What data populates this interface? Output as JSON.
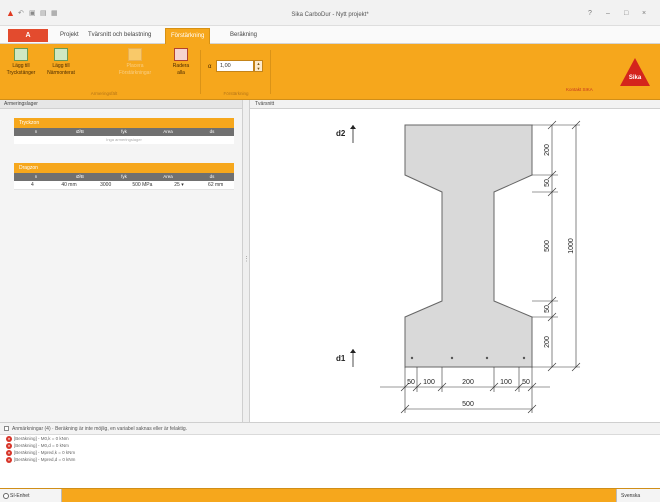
{
  "titlebar": {
    "title": "Sika CarboDur - Nytt projekt*",
    "quick_icons": [
      "undo-icon",
      "save-icon",
      "save-as-icon",
      "print-icon"
    ],
    "controls": [
      "?",
      "–",
      "□",
      "×"
    ]
  },
  "menu": {
    "file_label": "A",
    "tabs": [
      {
        "label": "Projekt",
        "active": false
      },
      {
        "label": "Tvärsnitt och belastning",
        "active": false
      },
      {
        "label": "Förstärkning",
        "active": true
      },
      {
        "label": "Beräkning",
        "active": false
      }
    ]
  },
  "ribbon": {
    "buttons": [
      {
        "label": "Lägg till\nTryckstänger",
        "icon": "add-strip-icon",
        "enabled": true
      },
      {
        "label": "Lägg till\nNärmonterat",
        "icon": "add-nsm-icon",
        "enabled": true
      },
      {
        "label": "Placera\nFörstärkningar",
        "icon": "place-icon",
        "enabled": false
      },
      {
        "label": "Radera\nalla",
        "icon": "delete-all-icon",
        "enabled": true
      }
    ],
    "group_labels": [
      "Armeringsfält",
      "Förstärkning"
    ],
    "factor_label": "α",
    "factor_value": "1,00",
    "accent": "#f6a71c"
  },
  "brand": {
    "logo_text": "Sika",
    "link": "Kontakt SIKA"
  },
  "left_panel": {
    "title": "Armeringslager",
    "top_box": {
      "title": "Tryckzon",
      "columns": [
        "n",
        "Ø/B",
        "fyk",
        "Area",
        "ds"
      ],
      "empty_text": "Inga armeringslager"
    },
    "bottom_box": {
      "title": "Dragzon",
      "columns": [
        "n",
        "Ø/B",
        "fyk",
        "Area",
        "ds"
      ],
      "rows": [
        [
          "4",
          "40 mm",
          "3000",
          "500 MPa",
          "25 ▾",
          "62 mm"
        ]
      ]
    }
  },
  "right_panel": {
    "title": "Tvärsnitt",
    "labels": {
      "d1": "d1",
      "d2": "d2"
    },
    "right_dims": [
      "200",
      "50",
      "500",
      "50",
      "200"
    ],
    "total_height": "1000",
    "bottom_dims": [
      "50",
      "100",
      "200",
      "100",
      "50"
    ],
    "total_width": "500",
    "section_fill": "#d9d9d9"
  },
  "messages": {
    "header": "Anmärkningar (4) · Beräkning är inte möjlig, en variabel saknas eller är felaktig.",
    "items": [
      "[Beräkning] - M0,k = 0 kNm",
      "[Beräkning] - M0,d = 0 kNm",
      "[Beräkning] - Mpred,k = 0 kNm",
      "[Beräkning] - Mpred,d = 0 kNm"
    ],
    "error_color": "#d7362a"
  },
  "statusbar": {
    "left": "SI-Enhet",
    "right": "Svenska"
  }
}
